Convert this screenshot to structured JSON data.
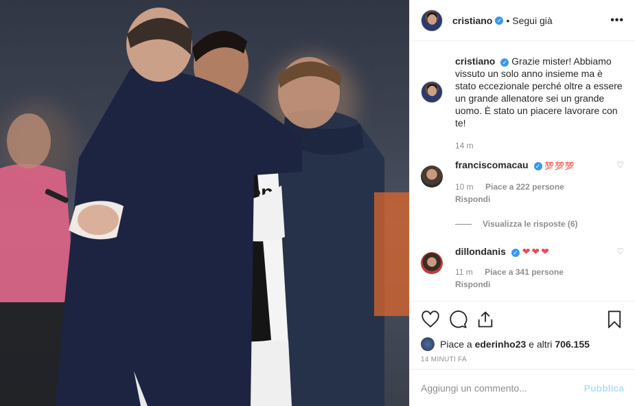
{
  "header": {
    "username": "cristiano",
    "separator": "•",
    "follow_status": "Segui già",
    "more_label": "•••"
  },
  "caption": {
    "username": "cristiano",
    "text": "Grazie mister! Abbiamo vissuto un solo anno insieme ma è stato eccezionale perché oltre a essere un grande allenatore sei un grande uomo. È stato un piacere lavorare con te!",
    "time": "14 m"
  },
  "comments": [
    {
      "username": "franciscomacau",
      "text": "💯💯💯",
      "time": "10 m",
      "likes": "Piace a 222 persone",
      "reply": "Rispondi",
      "view_replies": "Visualizza le risposte (6)"
    },
    {
      "username": "dillondanis",
      "text": "❤❤❤",
      "time": "11 m",
      "likes": "Piace a 341 persone",
      "reply": "Rispondi"
    }
  ],
  "likes": {
    "prefix": "Piace a ",
    "user": "ederinho23",
    "middle": " e altri ",
    "count": "706.155"
  },
  "timestamp": "14 MINUTI FA",
  "add_comment": {
    "placeholder": "Aggiungi un commento...",
    "publish_label": "Pubblica"
  },
  "colors": {
    "verified": "#3897f0",
    "publish_disabled": "#b2dffc",
    "secondary_text": "#8e8e8e"
  }
}
